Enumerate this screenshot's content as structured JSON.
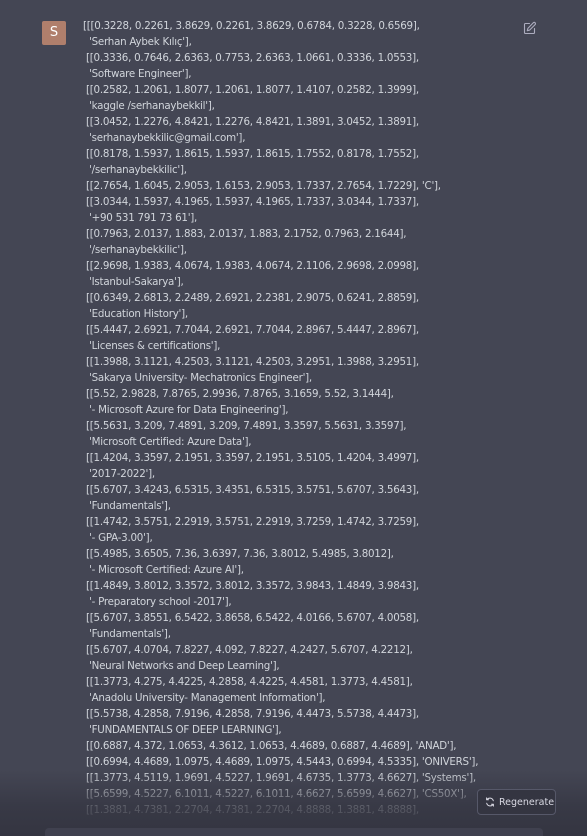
{
  "user": {
    "avatar_letter": "S",
    "avatar_color": "#b07f6c"
  },
  "message": {
    "lines": [
      "[[[0.3228, 0.2261, 3.8629, 0.2261, 3.8629, 0.6784, 0.3228, 0.6569],",
      "  'Serhan Aybek Kılıç'],",
      " [[0.3336, 0.7646, 2.6363, 0.7753, 2.6363, 1.0661, 0.3336, 1.0553],",
      "  'Software Engineer'],",
      " [[0.2582, 1.2061, 1.8077, 1.2061, 1.8077, 1.4107, 0.2582, 1.3999],",
      "  'kaggle /serhanaybekkil'],",
      " [[3.0452, 1.2276, 4.8421, 1.2276, 4.8421, 1.3891, 3.0452, 1.3891],",
      "  'serhanaybekkilic@gmail.com'],",
      " [[0.8178, 1.5937, 1.8615, 1.5937, 1.8615, 1.7552, 0.8178, 1.7552],",
      "  '/serhanaybekkilic'],",
      " [[2.7654, 1.6045, 2.9053, 1.6153, 2.9053, 1.7337, 2.7654, 1.7229], 'C'],",
      " [[3.0344, 1.5937, 4.1965, 1.5937, 4.1965, 1.7337, 3.0344, 1.7337],",
      "  '+90 531 791 73 61'],",
      " [[0.7963, 2.0137, 1.883, 2.0137, 1.883, 2.1752, 0.7963, 2.1644],",
      "  '/serhanaybekkilic'],",
      " [[2.9698, 1.9383, 4.0674, 1.9383, 4.0674, 2.1106, 2.9698, 2.0998],",
      "  'Istanbul-Sakarya'],",
      " [[0.6349, 2.6813, 2.2489, 2.6921, 2.2381, 2.9075, 0.6241, 2.8859],",
      "  'Education History'],",
      " [[5.4447, 2.6921, 7.7044, 2.6921, 7.7044, 2.8967, 5.4447, 2.8967],",
      "  'Licenses & certifications'],",
      " [[1.3988, 3.1121, 4.2503, 3.1121, 4.2503, 3.2951, 1.3988, 3.2951],",
      "  'Sakarya University- Mechatronics Engineer'],",
      " [[5.52, 2.9828, 7.8765, 2.9936, 7.8765, 3.1659, 5.52, 3.1444],",
      "  '- Microsoft Azure for Data Engineering'],",
      " [[5.5631, 3.209, 7.4891, 3.209, 7.4891, 3.3597, 5.5631, 3.3597],",
      "  'Microsoft Certified: Azure Data'],",
      " [[1.4204, 3.3597, 2.1951, 3.3597, 2.1951, 3.5105, 1.4204, 3.4997],",
      "  '2017-2022'],",
      " [[5.6707, 3.4243, 6.5315, 3.4351, 6.5315, 3.5751, 5.6707, 3.5643],",
      "  'Fundamentals'],",
      " [[1.4742, 3.5751, 2.2919, 3.5751, 2.2919, 3.7259, 1.4742, 3.7259],",
      "  '- GPA-3.00'],",
      " [[5.4985, 3.6505, 7.36, 3.6397, 7.36, 3.8012, 5.4985, 3.8012],",
      "  '- Microsoft Certified: Azure AI'],",
      " [[1.4849, 3.8012, 3.3572, 3.8012, 3.3572, 3.9843, 1.4849, 3.9843],",
      "  '- Preparatory school -2017'],",
      " [[5.6707, 3.8551, 6.5422, 3.8658, 6.5422, 4.0166, 5.6707, 4.0058],",
      "  'Fundamentals'],",
      " [[5.6707, 4.0704, 7.8227, 4.092, 7.8227, 4.2427, 5.6707, 4.2212],",
      "  'Neural Networks and Deep Learning'],",
      " [[1.3773, 4.275, 4.4225, 4.2858, 4.4225, 4.4581, 1.3773, 4.4581],",
      "  'Anadolu University- Management Information'],",
      " [[5.5738, 4.2858, 7.9196, 4.2858, 7.9196, 4.4473, 5.5738, 4.4473],",
      "  'FUNDAMENTALS OF DEEP LEARNING'],",
      " [[0.6887, 4.372, 1.0653, 4.3612, 1.0653, 4.4689, 0.6887, 4.4689], 'ANAD'],",
      " [[0.6994, 4.4689, 1.0975, 4.4689, 1.0975, 4.5443, 0.6994, 4.5335], 'ONIVERS'],",
      " [[1.3773, 4.5119, 1.9691, 4.5227, 1.9691, 4.6735, 1.3773, 4.6627], 'Systems'],",
      " [[5.6599, 4.5227, 6.1011, 4.5227, 6.1011, 4.6627, 5.6599, 4.6627], 'CS50X'],",
      " [[1.3881, 4.7381, 2.2704, 4.7381, 2.2704, 4.8888, 1.3881, 4.8888],"
    ]
  },
  "actions": {
    "regenerate_label": "Regenerate",
    "regenerate_icon": "refresh-icon",
    "edit_icon": "edit-icon"
  }
}
